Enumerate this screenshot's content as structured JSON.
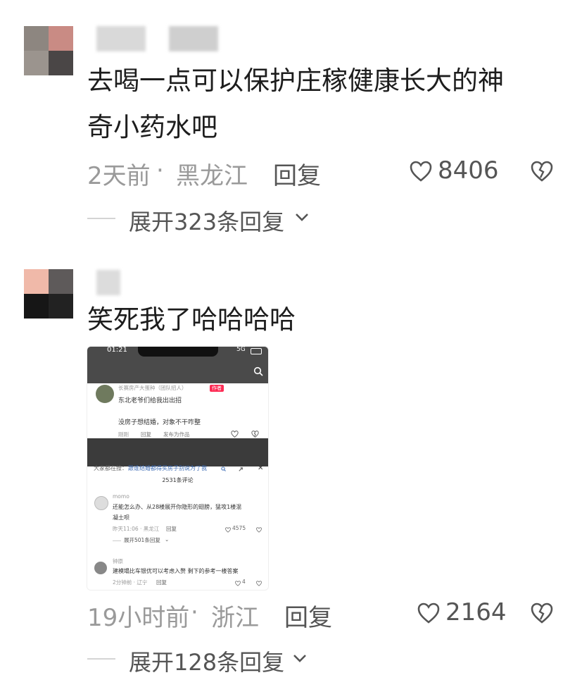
{
  "comments": [
    {
      "text_line1": "去喝一点可以保护庄稼健康长大的神",
      "text_line2": "奇小药水吧",
      "time": "2天前",
      "sep": "·",
      "location": "黑龙江",
      "reply_label": "回复",
      "likes": "8406",
      "expand_label": "展开323条回复"
    },
    {
      "text": "笑死我了哈哈哈哈",
      "time": "19小时前",
      "sep": "·",
      "location": "浙江",
      "reply_label": "回复",
      "likes": "2164",
      "expand_label": "展开128条回复"
    }
  ],
  "embedded_screenshot": {
    "status_time": "01:21",
    "status_signal": "5G",
    "author_name": "长赛房产大蛋种（团队招人）",
    "author_badge": "作者",
    "post_line1": "东北老爷们给我出出招",
    "post_line2": "没房子想结婚，对象不干咋整",
    "post_meta_time": "刚刚",
    "post_meta_reply": "回复",
    "post_meta_publish": "发布为作品",
    "search_prefix": "大家都在搜：",
    "search_query": "跟谁结婚都得买房子别说为了我",
    "comment_count": "2531条评论",
    "c1_user": "momo",
    "c1_line1": "还能怎么办、从28楼展开你隐形的翅膀，猛攻1楼混",
    "c1_line2": "凝土呗",
    "c1_meta": "昨天11:06 · 黑龙江",
    "c1_reply": "回复",
    "c1_likes": "4575",
    "c1_expand": "展开501条回复",
    "c2_user": "钟原",
    "c2_line1": "建模塌比车银优可以考虑入赘 剩下的参考一楼答案",
    "c2_meta": "2分钟前 · 辽宁",
    "c2_reply": "回复",
    "c2_likes": "4"
  },
  "colors": {
    "meta_gray": "#9a9a9a",
    "badge_red": "#fe2c55",
    "link_blue": "#3c6bb4"
  },
  "icons": [
    "heart-outline-icon",
    "broken-heart-icon",
    "chevron-down-icon",
    "search-icon",
    "close-icon",
    "refresh-icon"
  ]
}
